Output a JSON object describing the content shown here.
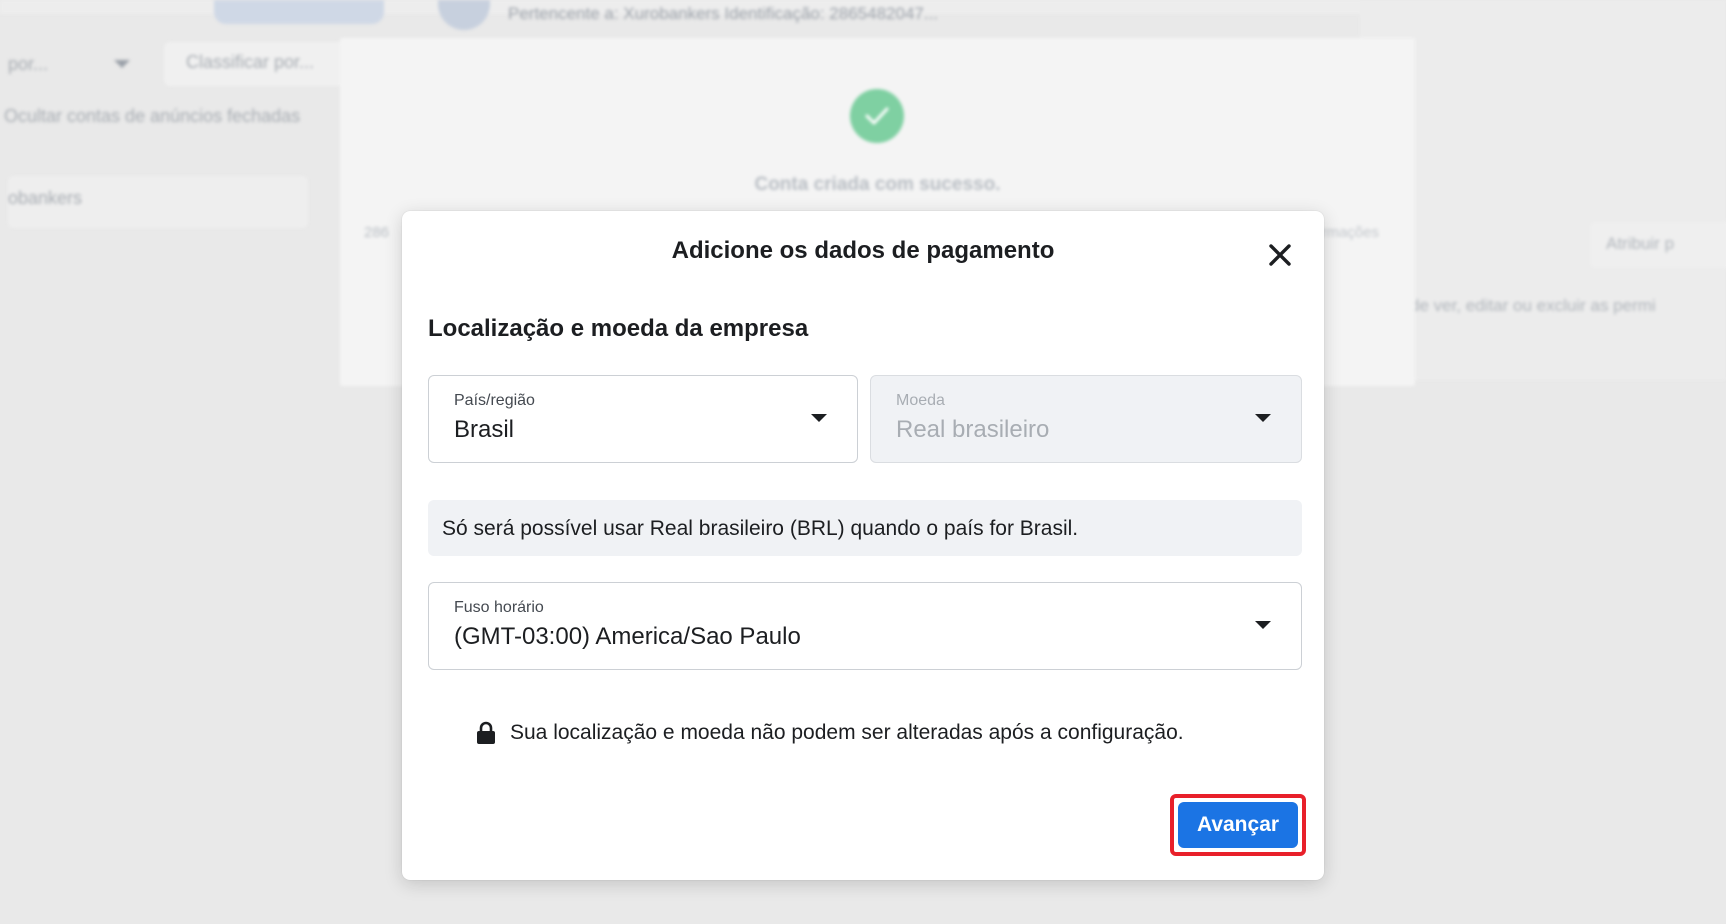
{
  "background": {
    "owner_text": "Pertencente a: Xurobankers  Identificação: 2865482047...",
    "filter_label": "por...",
    "sort_label": "Classificar por...",
    "hide_closed_label": "Ocultar contas de anúncios fechadas",
    "list_item_label": "obankers",
    "assign_button_label": "Atribuir p",
    "permissions_text": "de ver, editar ou excluir as permi",
    "success_message": "Conta criada com sucesso.",
    "account_id_prefix": "286",
    "info_link": "rmações"
  },
  "modal": {
    "title": "Adicione os dados de pagamento",
    "section_title": "Localização e moeda da empresa",
    "country": {
      "label": "País/região",
      "value": "Brasil"
    },
    "currency": {
      "label": "Moeda",
      "value": "Real brasileiro"
    },
    "notice": "Só será possível usar Real brasileiro (BRL) quando o país for Brasil.",
    "timezone": {
      "label": "Fuso horário",
      "value": "(GMT-03:00) America/Sao Paulo"
    },
    "lock_message": "Sua localização e moeda não podem ser alteradas após a configuração.",
    "next_button": "Avançar"
  },
  "colors": {
    "primary_button": "#1b74e4",
    "highlight": "#e8202a",
    "success": "#7fd0a2"
  },
  "icons": [
    "close-icon",
    "chevron-down-icon",
    "lock-icon",
    "check-icon"
  ]
}
